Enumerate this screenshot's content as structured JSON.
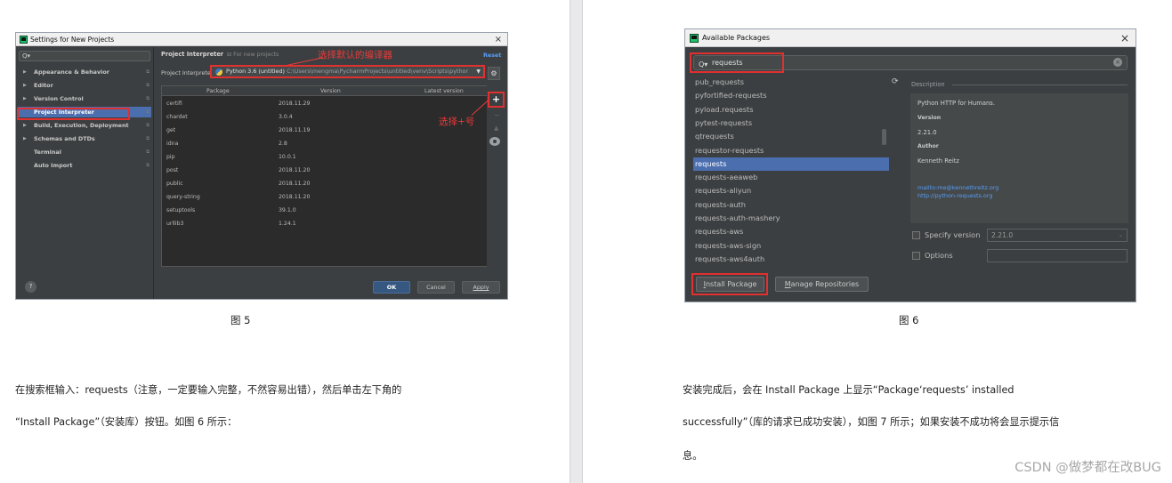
{
  "left_page": {
    "dialog": {
      "title": "Settings for New Projects",
      "close_glyph": "×",
      "search_glyph": "Q▾",
      "sidebar": [
        {
          "label": "Appearance & Behavior",
          "arrow": true
        },
        {
          "label": "Editor",
          "arrow": true
        },
        {
          "label": "Version Control",
          "arrow": true
        },
        {
          "label": "Project Interpreter",
          "arrow": false,
          "selected": true
        },
        {
          "label": "Build, Execution, Deployment",
          "arrow": true
        },
        {
          "label": "Schemas and DTDs",
          "arrow": true
        },
        {
          "label": "Terminal",
          "arrow": false
        },
        {
          "label": "Auto Import",
          "arrow": false
        }
      ],
      "panel_title": "Project Interpreter",
      "panel_subtitle": "⊟ For new projects",
      "reset_label": "Reset",
      "annotation_interpreter": "选择默认的编译器",
      "annotation_plus": "选择+号",
      "interpreter_label": "Project Interpreter:",
      "interpreter_value": "Python 3.6 (untitled)",
      "interpreter_path": " C:\\Users\\mengma\\PycharmProjects\\untitled\\venv\\Scripts\\pythor",
      "columns": [
        "Package",
        "Version",
        "Latest version"
      ],
      "rows": [
        [
          "certifi",
          "2018.11.29"
        ],
        [
          "chardet",
          "3.0.4"
        ],
        [
          "get",
          "2018.11.19"
        ],
        [
          "idna",
          "2.8"
        ],
        [
          "pip",
          "10.0.1"
        ],
        [
          "post",
          "2018.11.20"
        ],
        [
          "public",
          "2018.11.20"
        ],
        [
          "query-string",
          "2018.11.20"
        ],
        [
          "setuptools",
          "39.1.0"
        ],
        [
          "urllib3",
          "1.24.1"
        ]
      ],
      "plus_label": "+",
      "minus_label": "−",
      "up_label": "▲",
      "help_label": "?",
      "ok_label": "OK",
      "cancel_label": "Cancel",
      "apply_label": "Apply"
    },
    "caption": "图 5",
    "paragraph_line1": "在搜索框输入：requests（注意，一定要输入完整，不然容易出错），然后单击左下角的",
    "paragraph_line2": "“Install Package”（安装库）按钮。如图 6 所示："
  },
  "right_page": {
    "dialog": {
      "title": "Available Packages",
      "close_glyph": "×",
      "search_glyph": "Q▾",
      "search_value": "requests",
      "clear_glyph": "×",
      "refresh_glyph": "⟳",
      "packages": [
        "pub_requests",
        "pyfortified-requests",
        "pyload.requests",
        "pytest-requests",
        "qtrequests",
        "requestor-requests",
        "requests",
        "requests-aeaweb",
        "requests-aliyun",
        "requests-auth",
        "requests-auth-mashery",
        "requests-aws",
        "requests-aws-sign",
        "requests-aws4auth"
      ],
      "selected_package": "requests",
      "description_label": "Description",
      "description": {
        "summary": "Python HTTP for Humans.",
        "version_label": "Version",
        "version": "2.21.0",
        "author_label": "Author",
        "author": "Kenneth Reitz",
        "email_link": "mailto:me@kennethreitz.org",
        "home_link": "http://python-requests.org"
      },
      "specify_version_label": "Specify version",
      "specify_version_value": "2.21.0",
      "dropdown_glyph": "⌄",
      "options_label": "Options",
      "install_label": "Install Package",
      "install_mnemonic": "I",
      "install_rest": "nstall Package",
      "manage_mnemonic": "M",
      "manage_rest": "anage Repositories"
    },
    "caption": "图 6",
    "paragraph_line1": "安装完成后，会在 Install Package 上显示“Package‘requests’ installed",
    "paragraph_line2": "successfully”（库的请求已成功安装），如图 7 所示；如果安装不成功将会显示提示信",
    "paragraph_line3": "息。"
  },
  "watermark": "CSDN @做梦都在改BUG",
  "colors": {
    "ide_bg": "#3c3f41",
    "selection": "#4b6eaf",
    "highlight_red": "#e03030",
    "link_blue": "#589df6"
  }
}
